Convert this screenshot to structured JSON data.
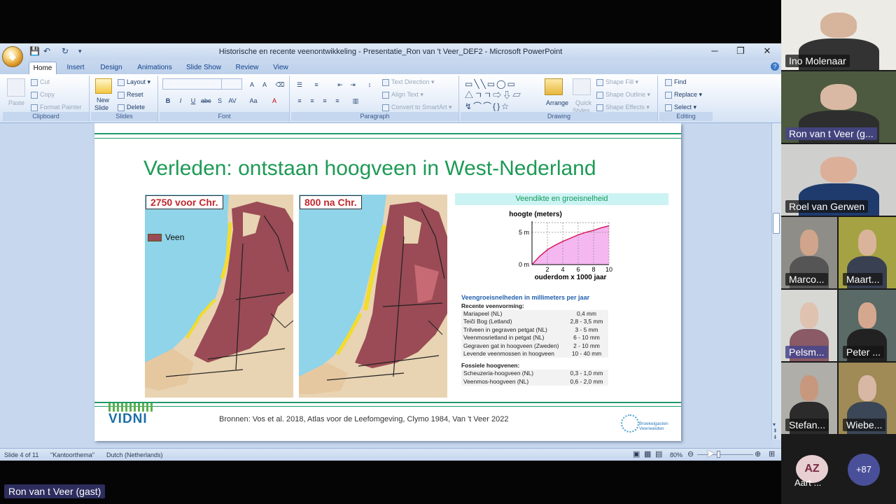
{
  "window": {
    "title": "Historische en recente veenontwikkeling - Presentatie_Ron van 't Veer_DEF2 - Microsoft PowerPoint"
  },
  "tabs": [
    "Home",
    "Insert",
    "Design",
    "Animations",
    "Slide Show",
    "Review",
    "View"
  ],
  "ribbon": {
    "clipboard": {
      "label": "Clipboard",
      "paste": "Paste",
      "cut": "Cut",
      "copy": "Copy",
      "format_painter": "Format Painter"
    },
    "slides": {
      "label": "Slides",
      "new_slide": "New",
      "new_slide2": "Slide",
      "layout": "Layout",
      "reset": "Reset",
      "delete": "Delete"
    },
    "font": {
      "label": "Font"
    },
    "paragraph": {
      "label": "Paragraph",
      "text_direction": "Text Direction",
      "align_text": "Align Text",
      "convert": "Convert to SmartArt"
    },
    "drawing": {
      "label": "Drawing",
      "arrange": "Arrange",
      "quick": "Quick",
      "styles": "Styles",
      "shape_fill": "Shape Fill",
      "shape_outline": "Shape Outline",
      "shape_effects": "Shape Effects"
    },
    "editing": {
      "label": "Editing",
      "find": "Find",
      "replace": "Replace",
      "select": "Select"
    }
  },
  "slide": {
    "title": "Verleden: ontstaan hoogveen in West-Nederland",
    "map1_label": "2750 voor Chr.",
    "map2_label": "800 na Chr.",
    "legend_label": "Veen",
    "panel_heading": "Veendikte en groeisnelheid",
    "growth_heading": "Veengroeisnelheden in millimeters per jaar",
    "recent_heading": "Recente veenvorming:",
    "recent_rows": [
      {
        "name": "Mariapeel (NL)",
        "rate": "0,4 mm"
      },
      {
        "name": "Teiči Bog (Letland)",
        "rate": "2,8 - 3,5 mm"
      },
      {
        "name": "Trilveen in gegraven petgat (NL)",
        "rate": "3 - 5 mm"
      },
      {
        "name": "Veenmosrietland in petgat (NL)",
        "rate": "6 - 10 mm"
      },
      {
        "name": "Gegraven gat in hoogveen (Zweden)",
        "rate": "2 - 10 mm"
      },
      {
        "name": "Levende veenmossen in hoogveen",
        "rate": "10 - 40 mm"
      }
    ],
    "fossil_heading": "Fossiele hoogvenen:",
    "fossil_rows": [
      {
        "name": "Scheuzeria-hoogveen (NL)",
        "rate": "0,3 - 1,0 mm"
      },
      {
        "name": "Veenmos-hoogveen (NL)",
        "rate": "0,6 - 2,0 mm"
      }
    ],
    "sources": "Bronnen: Vos et al. 2018, Atlas voor de Leefomgeving, Clymo 1984, Van 't Veer 2022",
    "logo_left": "VIDNI",
    "logo_right": "Broekeigasten Veenweiden"
  },
  "chart_data": {
    "type": "area",
    "ylabel": "hoogte (meters)",
    "xlabel": "ouderdom x 1000 jaar",
    "x": [
      0,
      1,
      2,
      3,
      4,
      5,
      6,
      7,
      8,
      9,
      10
    ],
    "y": [
      0,
      1.3,
      2.3,
      3.0,
      3.6,
      4.1,
      4.6,
      5.0,
      5.3,
      5.7,
      6.0
    ],
    "xticks": [
      "2",
      "4",
      "6",
      "8",
      "10"
    ],
    "yticks": [
      "0 m",
      "5 m"
    ],
    "xlim": [
      0,
      10
    ],
    "ylim": [
      0,
      6.5
    ],
    "fill_color": "#f5b7f0",
    "line_color": "#d81b60"
  },
  "status": {
    "slide": "Slide 4 of 11",
    "theme": "\"Kantoorthema\"",
    "language": "Dutch (Netherlands)",
    "zoom": "80%"
  },
  "participants": [
    {
      "name": "Ino Molenaar"
    },
    {
      "name": "Ron van t Veer (g..."
    },
    {
      "name": "Roel van Gerwen"
    },
    {
      "name": "Marco..."
    },
    {
      "name": "Maart..."
    },
    {
      "name": "Pelsm..."
    },
    {
      "name": "Peter ..."
    },
    {
      "name": "Stefan..."
    },
    {
      "name": "Wiebe..."
    }
  ],
  "extra": {
    "az_initials": "AZ",
    "az_name": "Aart ...",
    "more_count": "+87",
    "speaker": "Ron van t Veer (gast)"
  }
}
